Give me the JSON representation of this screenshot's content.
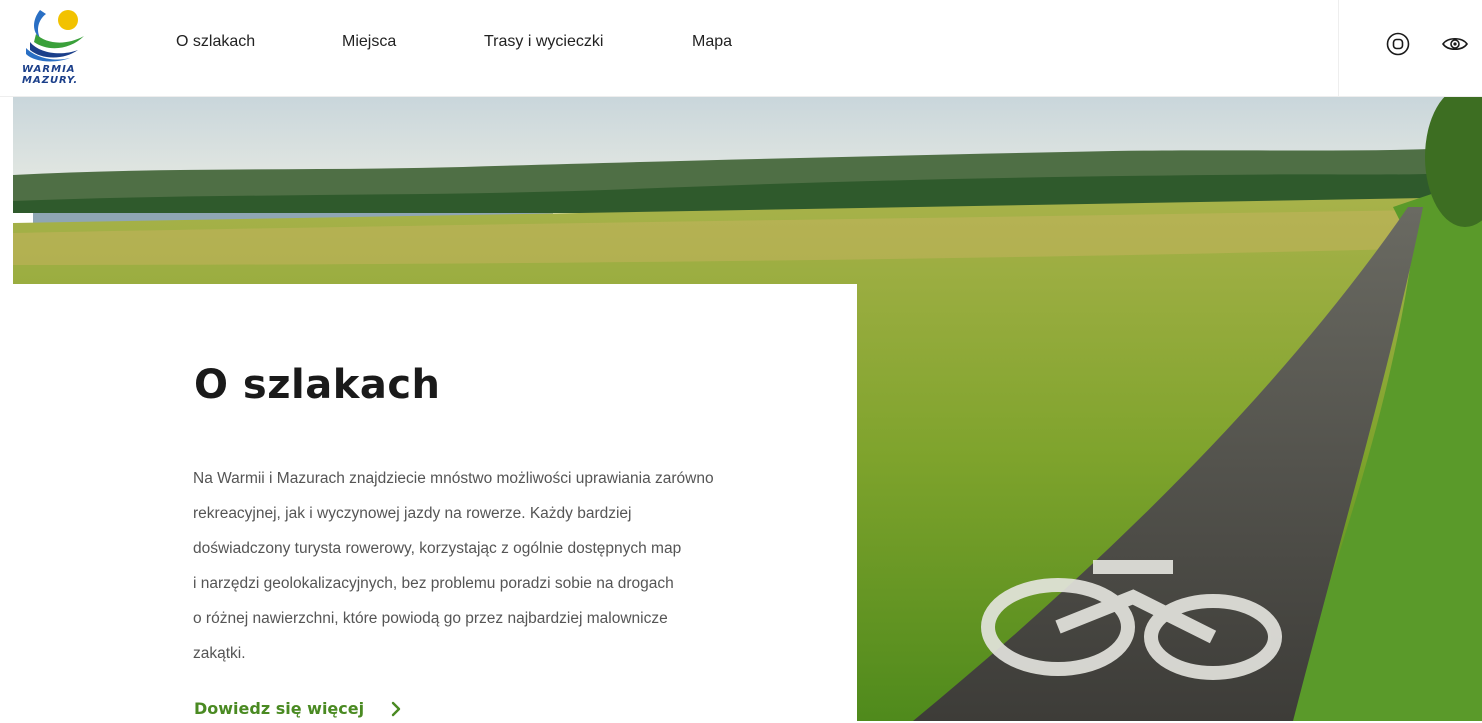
{
  "brand": {
    "logo_text_line1": "WARMIA",
    "logo_text_line2": "MAZURY."
  },
  "nav": {
    "items": [
      {
        "label": "O szlakach"
      },
      {
        "label": "Miejsca"
      },
      {
        "label": "Trasy i wycieczki"
      },
      {
        "label": "Mapa"
      }
    ]
  },
  "header_icons": [
    "contrast-icon",
    "eye-icon"
  ],
  "hero": {
    "title": "O szlakach",
    "paragraph_lines": [
      "Na Warmii i Mazurach znajdziecie mnóstwo możliwości uprawiania zarówno",
      "rekreacyjnej, jak i wyczynowej jazdy na rowerze. Każdy bardziej",
      "doświadczony turysta rowerowy, korzystając z ogólnie dostępnych map",
      "i narzędzi geolokalizacyjnych, bez problemu poradzi sobie na drogach",
      "o różnej nawierzchni, które powiodą go przez najbardziej malownicze",
      "zakątki."
    ],
    "more_link": "Dowiedz się więcej"
  },
  "colors": {
    "accent_green": "#4a8a22",
    "logo_blue": "#1b3f8a",
    "logo_yellow": "#f2c200",
    "text_dark": "#1a1a1a",
    "text_muted": "#555555"
  }
}
